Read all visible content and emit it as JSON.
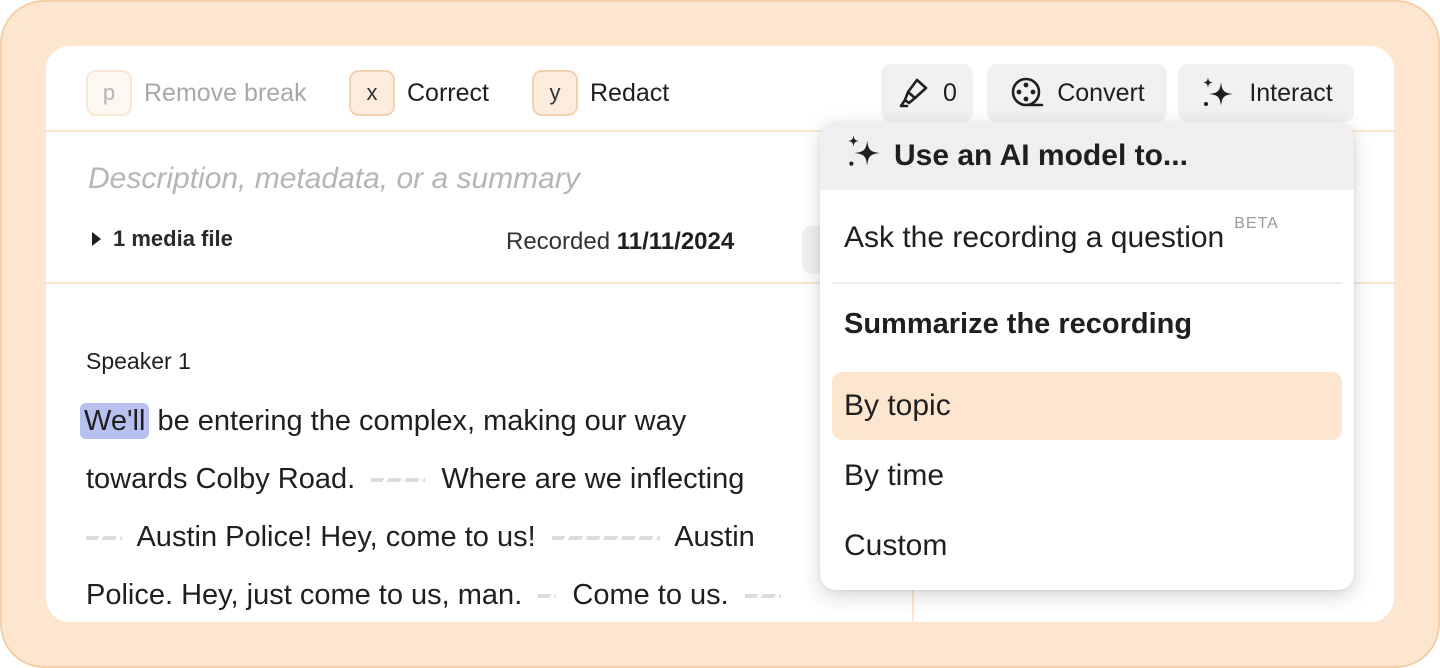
{
  "toolbar": {
    "remove_break": {
      "key": "p",
      "label": "Remove break"
    },
    "correct": {
      "key": "x",
      "label": "Correct"
    },
    "redact": {
      "key": "y",
      "label": "Redact"
    },
    "highlighter_count": "0",
    "convert_label": "Convert",
    "interact_label": "Interact"
  },
  "details": {
    "description_placeholder": "Description, metadata, or a summary",
    "media_files": "1 media file",
    "recorded_label": "Recorded",
    "recorded_date": "11/11/2024"
  },
  "transcript": {
    "speaker": "Speaker 1",
    "line1_highlight": "We'll",
    "line1_rest": "be entering the complex, making our way",
    "line2_a": "towards Colby Road.",
    "line2_b": "Where are we inflecting",
    "line3_a": "Austin Police! Hey, come to us!",
    "line3_b": "Austin",
    "line4_a": "Police. Hey, just come to us, man.",
    "line4_b": "Come to us."
  },
  "ai_menu": {
    "header": "Use an AI model to...",
    "ask_question": "Ask the recording a question",
    "beta_badge": "BETA",
    "summarize_heading": "Summarize the recording",
    "by_topic": "By topic",
    "by_time": "By time",
    "custom": "Custom"
  },
  "colors": {
    "frame_bg": "#fde6cf",
    "accent_highlight": "#b6c1f0",
    "active_item_bg": "#fde6cf"
  },
  "icons": [
    "highlighter-icon",
    "film-reel-icon",
    "sparkles-icon"
  ]
}
